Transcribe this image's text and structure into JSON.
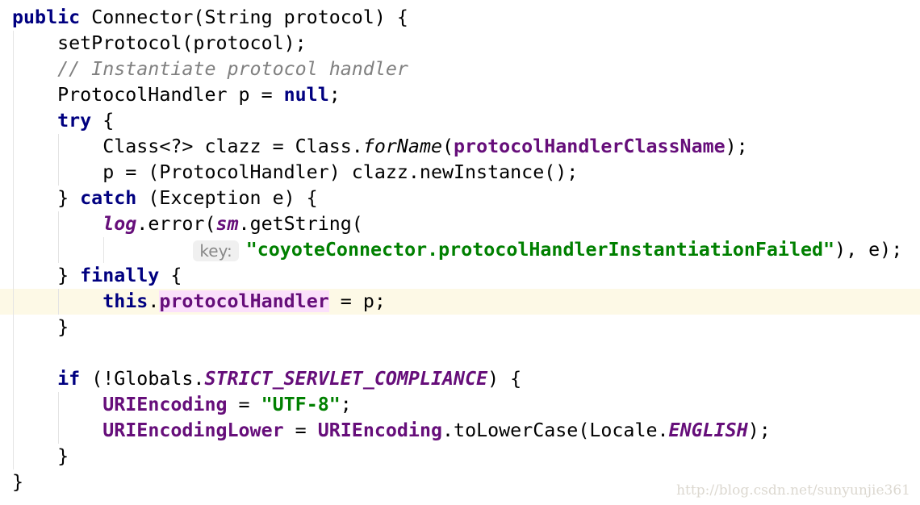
{
  "editor": {
    "current_line": 12,
    "lines": [
      [
        [
          "public ",
          "kw"
        ],
        [
          "Connector(String protocol) {",
          ""
        ]
      ],
      [
        [
          "    setProtocol(protocol);",
          ""
        ]
      ],
      [
        [
          "    // Instantiate protocol handler",
          "cmt"
        ]
      ],
      [
        [
          "    ProtocolHandler p = ",
          ""
        ],
        [
          "null",
          "kw"
        ],
        [
          ";",
          ""
        ]
      ],
      [
        [
          "    ",
          ""
        ],
        [
          "try",
          "kw"
        ],
        [
          " {",
          ""
        ]
      ],
      [
        [
          "        Class<?> clazz = Class.",
          ""
        ],
        [
          "forName",
          "smeth"
        ],
        [
          "(",
          ""
        ],
        [
          "protocolHandlerClassName",
          "fld"
        ],
        [
          ");",
          ""
        ]
      ],
      [
        [
          "        p = (ProtocolHandler) clazz.newInstance();",
          ""
        ]
      ],
      [
        [
          "    } ",
          ""
        ],
        [
          "catch",
          "kw"
        ],
        [
          " (Exception e) {",
          ""
        ]
      ],
      [
        [
          "        ",
          ""
        ],
        [
          "log",
          "sfld"
        ],
        [
          ".error(",
          ""
        ],
        [
          "sm",
          "sfld"
        ],
        [
          ".getString(",
          ""
        ]
      ],
      [
        [
          "                ",
          ""
        ],
        [
          "key:",
          "inlay"
        ],
        [
          "\"coyoteConnector.protocolHandlerInstantiationFailed\"",
          "str"
        ],
        [
          "), e);",
          ""
        ]
      ],
      [
        [
          "    } ",
          ""
        ],
        [
          "finally",
          "kw"
        ],
        [
          " {",
          ""
        ]
      ],
      [
        [
          "        ",
          ""
        ],
        [
          "this",
          "kw"
        ],
        [
          ".",
          ""
        ],
        [
          "protocolHandler",
          "fld hl"
        ],
        [
          " = p;",
          ""
        ]
      ],
      [
        [
          "    }",
          ""
        ]
      ],
      [
        [
          "",
          ""
        ]
      ],
      [
        [
          "    ",
          ""
        ],
        [
          "if",
          "kw"
        ],
        [
          " (!Globals.",
          ""
        ],
        [
          "STRICT_SERVLET_COMPLIANCE",
          "sfld"
        ],
        [
          ") {",
          ""
        ]
      ],
      [
        [
          "        ",
          ""
        ],
        [
          "URIEncoding",
          "fld"
        ],
        [
          " = ",
          ""
        ],
        [
          "\"UTF-8\"",
          "str"
        ],
        [
          ";",
          ""
        ]
      ],
      [
        [
          "        ",
          ""
        ],
        [
          "URIEncodingLower",
          "fld"
        ],
        [
          " = ",
          ""
        ],
        [
          "URIEncoding",
          "fld"
        ],
        [
          ".toLowerCase(Locale.",
          ""
        ],
        [
          "ENGLISH",
          "sfld"
        ],
        [
          ");",
          ""
        ]
      ],
      [
        [
          "    }",
          ""
        ]
      ],
      [
        [
          "}",
          ""
        ]
      ]
    ]
  },
  "watermark": "http://blog.csdn.net/sunyunjie361"
}
